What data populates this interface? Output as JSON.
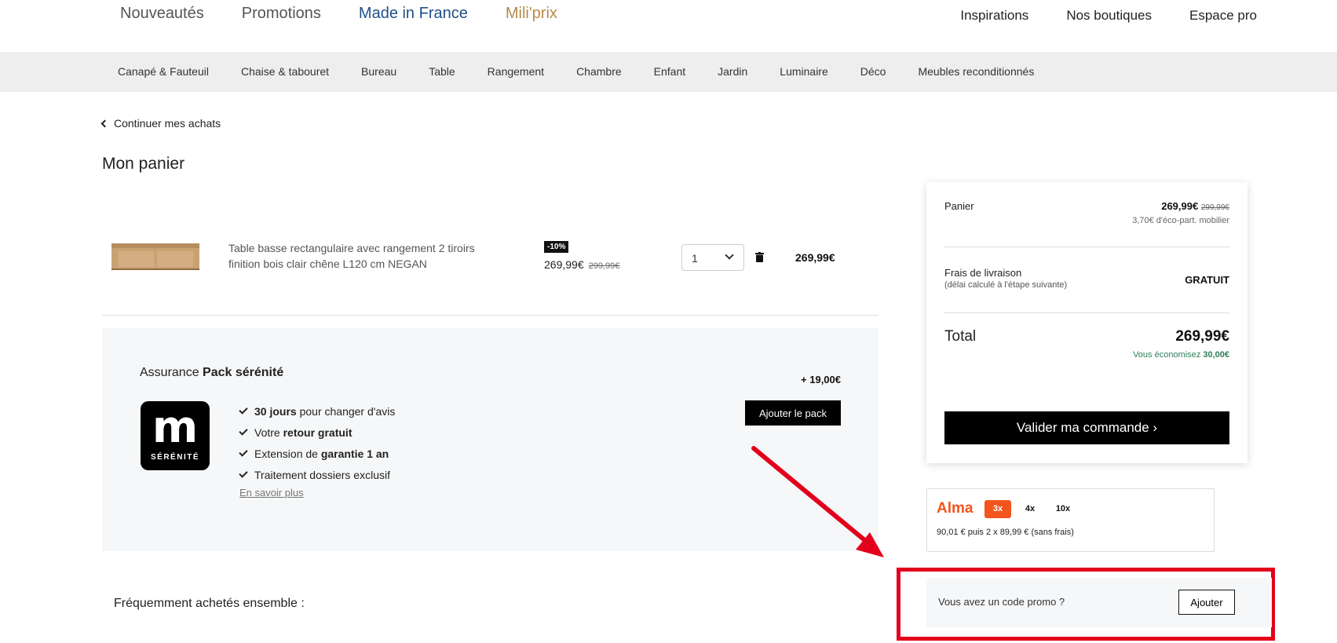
{
  "topnav": {
    "left": [
      {
        "label": "Nouveautés",
        "color": "#555555"
      },
      {
        "label": "Promotions",
        "color": "#555555"
      },
      {
        "label": "Made in France",
        "color": "#1f4f8a"
      },
      {
        "label": "Mili'prix",
        "color": "#b5894b"
      }
    ],
    "right": [
      "Inspirations",
      "Nos boutiques",
      "Espace pro"
    ]
  },
  "categories": [
    "Canapé & Fauteuil",
    "Chaise & tabouret",
    "Bureau",
    "Table",
    "Rangement",
    "Chambre",
    "Enfant",
    "Jardin",
    "Luminaire",
    "Déco",
    "Meubles reconditionnés"
  ],
  "back_label": "Continuer mes achats",
  "page_title": "Mon panier",
  "item": {
    "name": "Table basse rectangulaire avec rangement 2 tiroirs finition bois clair chêne L120 cm NEGAN",
    "discount": "-10%",
    "price": "269,99€",
    "old_price": "299,99€",
    "quantity": "1",
    "total": "269,99€"
  },
  "pack": {
    "title_prefix": "Assurance",
    "title_bold": "Pack sérénité",
    "logo_letter": "m",
    "logo_caption": "SÉRÉNITÉ",
    "benefits": [
      {
        "bold": "30 jours",
        "rest": " pour changer d'avis",
        "bold_first": true
      },
      {
        "pre": "Votre ",
        "bold": "retour gratuit"
      },
      {
        "pre": "Extension de ",
        "bold": "garantie 1 an"
      },
      {
        "pre": "Traitement dossiers exclusif"
      }
    ],
    "learn_more": "En savoir plus",
    "price": "+ 19,00€",
    "button": "Ajouter le pack"
  },
  "frequently": "Fréquemment achetés ensemble :",
  "summary": {
    "cart_label": "Panier",
    "cart_price": "269,99€",
    "cart_old_price": "299,99€",
    "eco_part": "3,70€ d'éco-part. mobilier",
    "shipping_label": "Frais de livraison",
    "shipping_sub": "(délai calculé à l'étape suivante)",
    "shipping_value": "GRATUIT",
    "total_label": "Total",
    "total_value": "269,99€",
    "savings_prefix": "Vous économisez",
    "savings_value": "30,00€",
    "validate": "Valider ma commande ›"
  },
  "alma": {
    "logo": "Alma",
    "tabs": [
      "3x",
      "4x",
      "10x"
    ],
    "active_tab": "3x",
    "text": "90,01 € puis 2 x 89,99 € (sans frais)"
  },
  "promo": {
    "text": "Vous avez un code promo ?",
    "button": "Ajouter"
  },
  "colors": {
    "accent_alma": "#f2561d",
    "highlight": "#e3001b",
    "savings": "#2d7f5b"
  }
}
